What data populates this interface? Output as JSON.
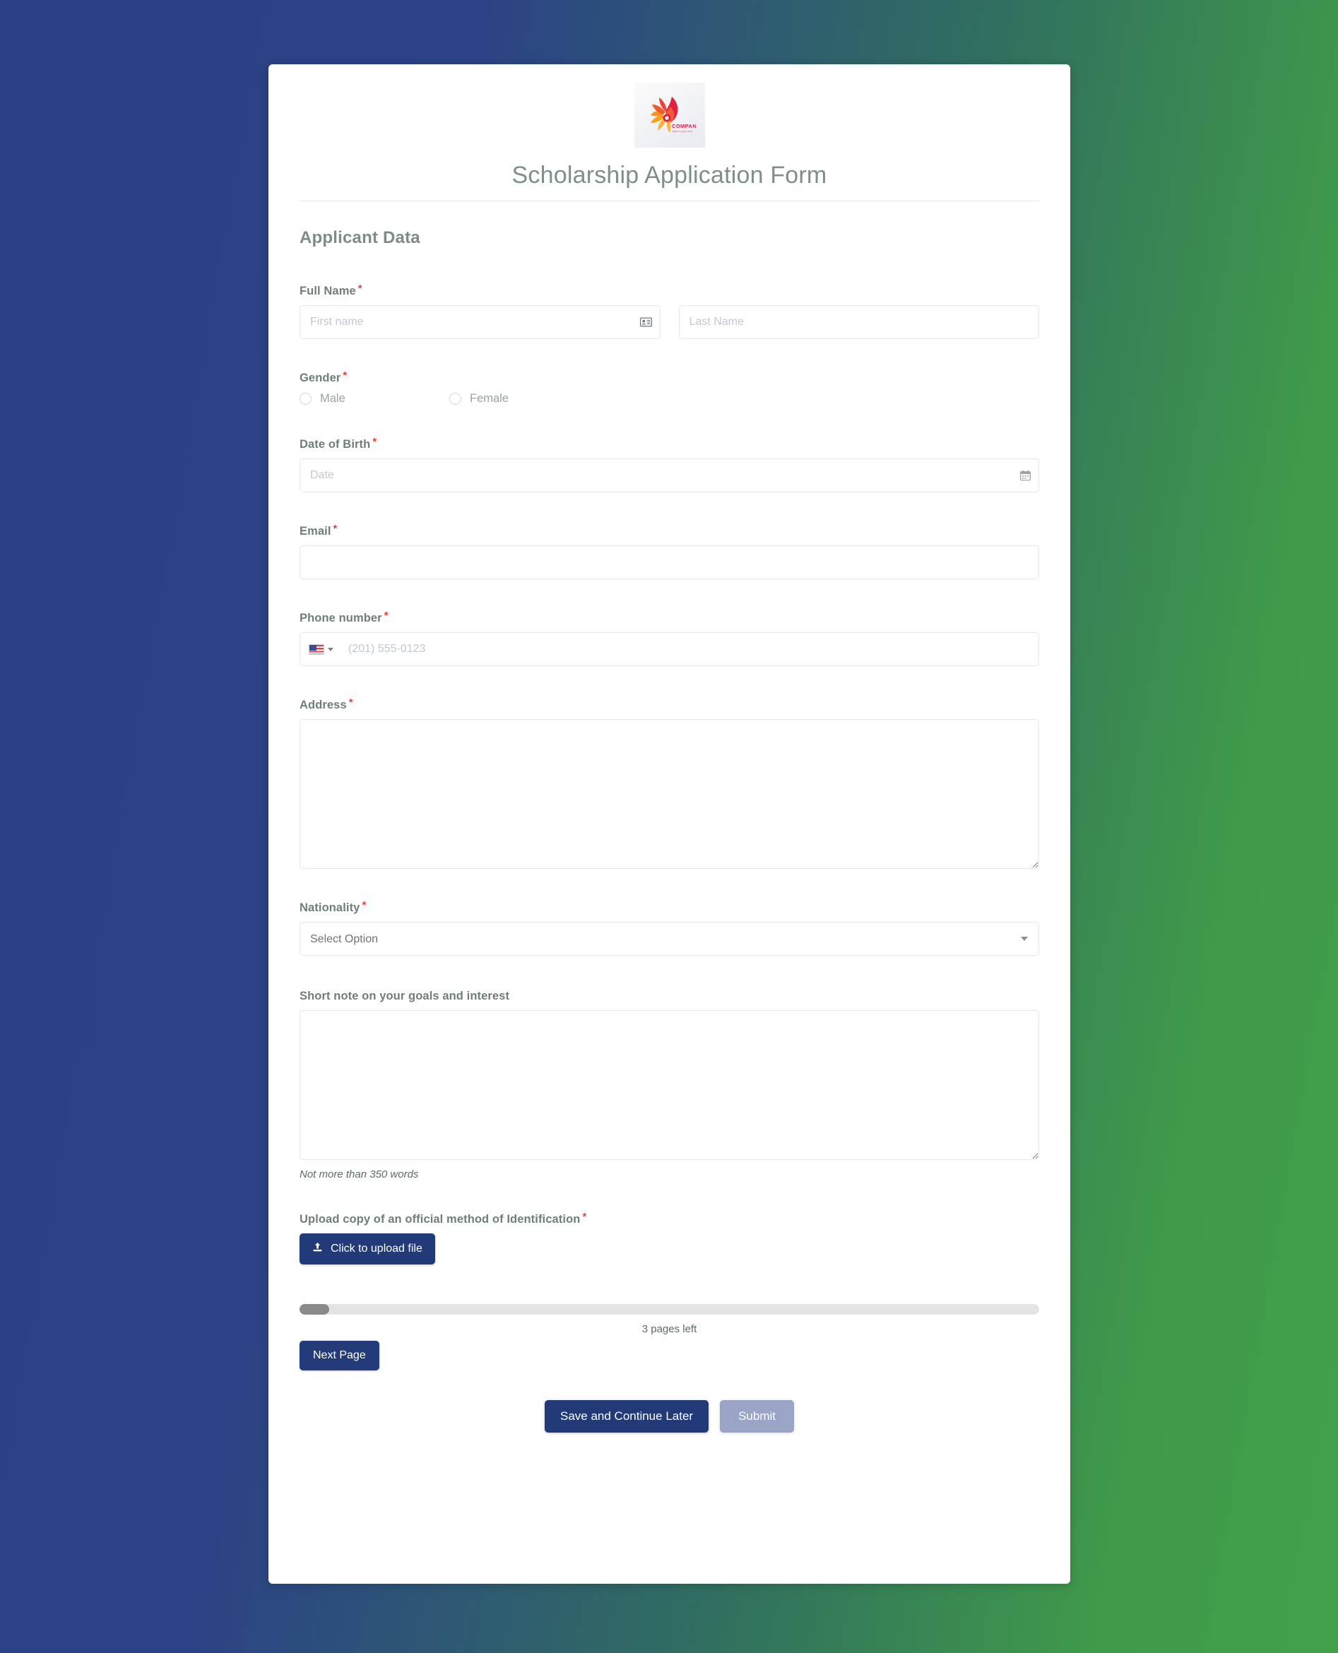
{
  "background": {
    "from": "#2a4183",
    "to": "#42a04b"
  },
  "header": {
    "logo_icon": "flame-flower-logo-icon",
    "title": "Scholarship Application Form"
  },
  "section": {
    "title": "Applicant Data"
  },
  "fields": {
    "full_name": {
      "label": "Full Name",
      "required": true,
      "first": {
        "placeholder": "First name",
        "value": "",
        "icon": "id-card-icon"
      },
      "last": {
        "placeholder": "Last Name",
        "value": ""
      }
    },
    "gender": {
      "label": "Gender",
      "required": true,
      "options": [
        {
          "label": "Male",
          "selected": false
        },
        {
          "label": "Female",
          "selected": false
        }
      ]
    },
    "date_of_birth": {
      "label": "Date of Birth",
      "required": true,
      "placeholder": "Date",
      "value": "",
      "icon": "calendar-icon"
    },
    "email": {
      "label": "Email",
      "required": true,
      "placeholder": "",
      "value": ""
    },
    "phone": {
      "label": "Phone number",
      "required": true,
      "country_flag": "us-flag-icon",
      "placeholder": "(201) 555-0123",
      "value": ""
    },
    "address": {
      "label": "Address",
      "required": true,
      "placeholder": "",
      "value": ""
    },
    "nationality": {
      "label": "Nationality",
      "required": true,
      "selected": "Select Option",
      "options": [
        "Select Option"
      ]
    },
    "short_note": {
      "label": "Short note on your goals and interest",
      "required": false,
      "placeholder": "",
      "value": "",
      "helper": "Not more than 350 words"
    },
    "upload": {
      "label": "Upload copy of an official method of Identification",
      "required": true,
      "button_label": "Click to upload file",
      "button_icon": "upload-icon",
      "button_color": "#223a77"
    }
  },
  "progress": {
    "percent": 4,
    "pages_left_text": "3 pages left"
  },
  "actions": {
    "next_page": "Next Page",
    "save_continue": "Save and Continue Later",
    "submit": "Submit",
    "submit_disabled": true
  }
}
